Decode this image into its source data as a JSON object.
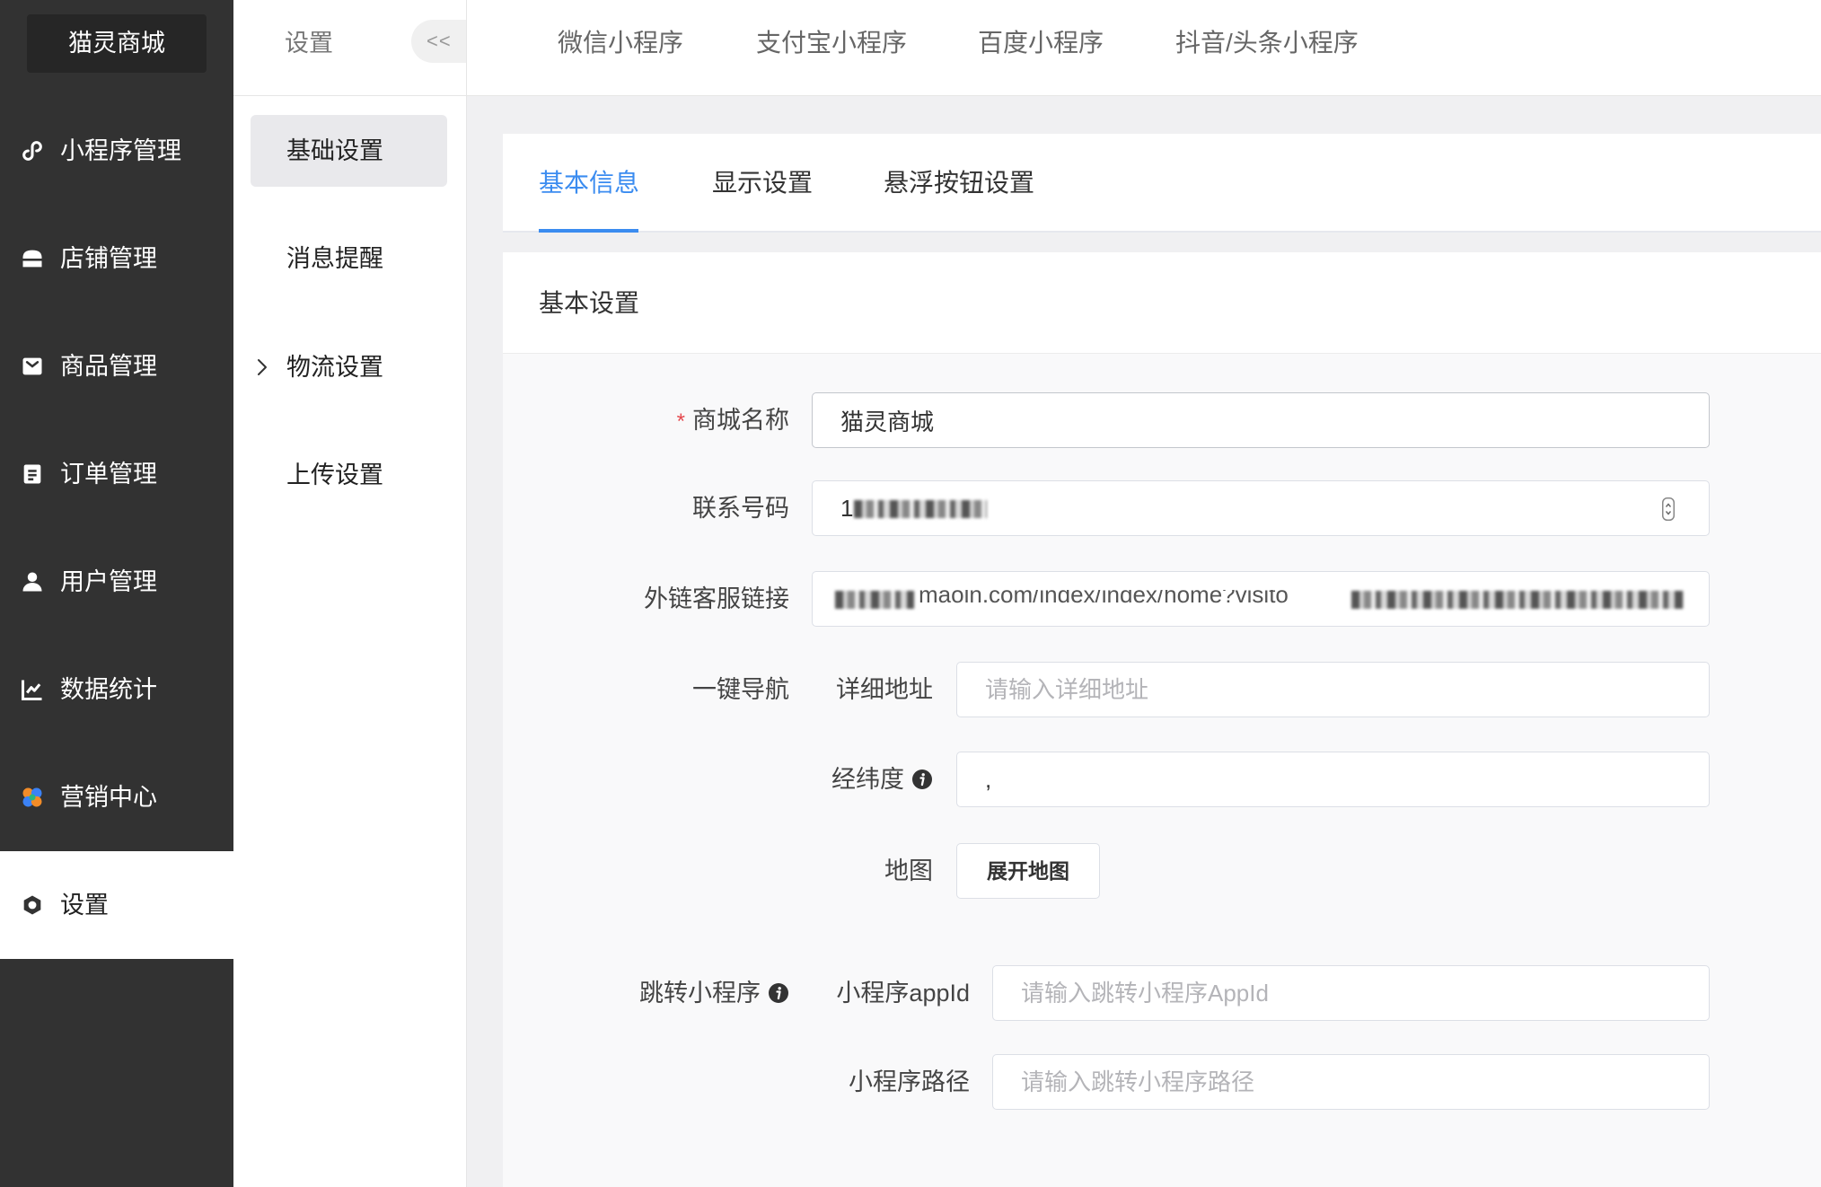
{
  "app": {
    "logo": "猫灵商城"
  },
  "sidebar": {
    "active_index": 7,
    "items": [
      {
        "label": "小程序管理",
        "icon": "miniprogram-icon"
      },
      {
        "label": "店铺管理",
        "icon": "store-icon"
      },
      {
        "label": "商品管理",
        "icon": "goods-icon"
      },
      {
        "label": "订单管理",
        "icon": "order-icon"
      },
      {
        "label": "用户管理",
        "icon": "user-icon"
      },
      {
        "label": "数据统计",
        "icon": "chart-icon"
      },
      {
        "label": "营销中心",
        "icon": "marketing-icon"
      },
      {
        "label": "设置",
        "icon": "settings-icon"
      }
    ]
  },
  "submenu": {
    "title": "设置",
    "collapse_label": "<<",
    "active_index": 0,
    "items": [
      {
        "label": "基础设置"
      },
      {
        "label": "消息提醒"
      },
      {
        "label": "物流设置",
        "icon": "chevron-right-icon"
      },
      {
        "label": "上传设置"
      }
    ]
  },
  "top_tabs": [
    {
      "label": "微信小程序"
    },
    {
      "label": "支付宝小程序"
    },
    {
      "label": "百度小程序"
    },
    {
      "label": "抖音/头条小程序"
    }
  ],
  "content_tabs": {
    "active_index": 0,
    "items": [
      {
        "label": "基本信息"
      },
      {
        "label": "显示设置"
      },
      {
        "label": "悬浮按钮设置"
      }
    ]
  },
  "section": {
    "title": "基本设置"
  },
  "form": {
    "shop_name": {
      "required_mark": "*",
      "label": "商城名称",
      "value": "猫灵商城"
    },
    "phone": {
      "label": "联系号码",
      "value": "1"
    },
    "service_link": {
      "label": "外链客服链接",
      "value": "maoln.com/index/index/home?visito"
    },
    "navigation": {
      "label": "一键导航",
      "address": {
        "label": "详细地址",
        "placeholder": "请输入详细地址",
        "value": ""
      },
      "latlng": {
        "label": "经纬度",
        "value": ","
      },
      "map": {
        "label": "地图",
        "button": "展开地图"
      }
    },
    "jump": {
      "label": "跳转小程序",
      "appid": {
        "label": "小程序appId",
        "placeholder": "请输入跳转小程序AppId",
        "value": ""
      },
      "path": {
        "label": "小程序路径",
        "placeholder": "请输入跳转小程序路径",
        "value": ""
      }
    }
  },
  "colors": {
    "accent": "#3b8cf0",
    "sidebar_bg": "#323232",
    "required": "#e5484d",
    "page_bg": "#f0f0f2"
  }
}
